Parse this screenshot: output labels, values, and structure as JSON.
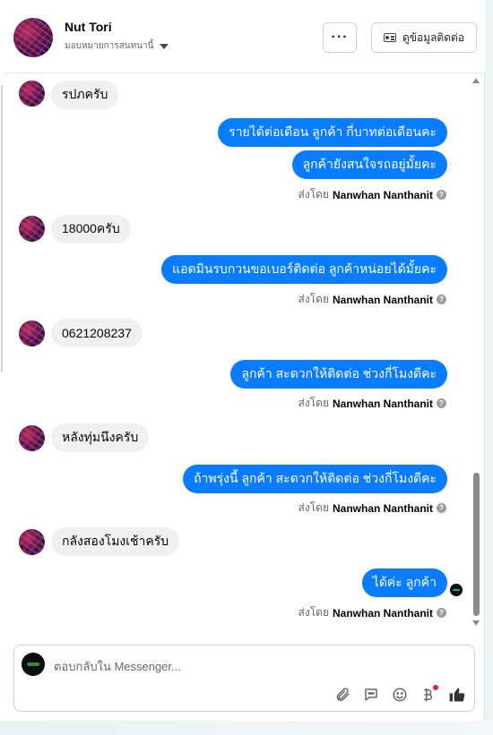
{
  "header": {
    "name": "Nut Tori",
    "assign_label": "มอบหมายการสนทนานี้",
    "more_label": "···",
    "contact_label": "ดูข้อมูลติดต่อ"
  },
  "messages": [
    {
      "dir": "in",
      "text": "รปภครับ"
    },
    {
      "dir": "out",
      "text": "รายได้ต่อเดือน ลูกค้า กี่บาทต่อเดือนคะ"
    },
    {
      "dir": "out",
      "text": "ลูกค้ายังสนใจรถอยู่มั้ยคะ"
    },
    {
      "dir": "in",
      "text": "18000ครับ"
    },
    {
      "dir": "out",
      "text": "แอดมินรบกวนขอเบอร์ติดต่อ ลูกค้าหน่อยได้มั้ยคะ"
    },
    {
      "dir": "in",
      "text": "0621208237"
    },
    {
      "dir": "out",
      "text": "ลูกค้า สะดวกให้ติดต่อ ช่วงกี่โมงดีคะ"
    },
    {
      "dir": "in",
      "text": "หลังทุ่มนึงครับ"
    },
    {
      "dir": "out",
      "text": "ถ้าพรุ่งนี้ ลูกค้า สะดวกให้ติดต่อ ช่วงกี่โมงดีคะ"
    },
    {
      "dir": "in",
      "text": "กลังสองโมงเช้าครับ"
    },
    {
      "dir": "out",
      "text": "ได้ค่ะ ลูกค้า"
    }
  ],
  "sent_by": {
    "prefix": "ส่งโดย",
    "name": "Nanwhan Nanthanit",
    "info": "?"
  },
  "composer": {
    "placeholder": "ตอบกลับใน Messenger..."
  },
  "icons": {
    "attach": "paperclip-icon",
    "saved_reply": "chat-bubble-icon",
    "emoji": "smiley-icon",
    "payment": "baht-icon",
    "like": "thumbs-up-icon"
  },
  "colors": {
    "outgoing": "#0a7cff",
    "incoming": "#f0f0f0",
    "like": "#333333",
    "dot": "#e41e3f"
  }
}
